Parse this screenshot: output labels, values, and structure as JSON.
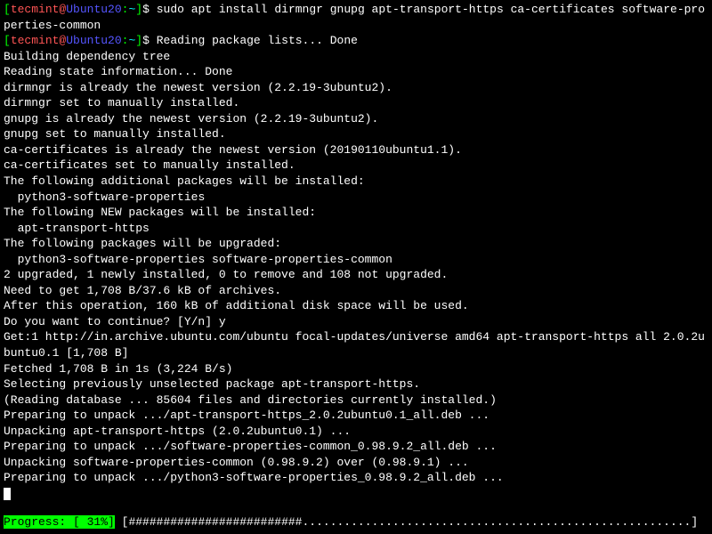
{
  "prompt1": {
    "user": "tecmint",
    "host": "Ubuntu20",
    "path": "~",
    "symbol": "$"
  },
  "command1": "sudo apt install dirmngr gnupg apt-transport-https ca-certificates software-properties-common",
  "prompt2": {
    "user": "tecmint",
    "host": "Ubuntu20",
    "path": "~",
    "symbol": "$"
  },
  "output_lines": [
    "Reading package lists... Done",
    "Building dependency tree",
    "Reading state information... Done",
    "dirmngr is already the newest version (2.2.19-3ubuntu2).",
    "dirmngr set to manually installed.",
    "gnupg is already the newest version (2.2.19-3ubuntu2).",
    "gnupg set to manually installed.",
    "ca-certificates is already the newest version (20190110ubuntu1.1).",
    "ca-certificates set to manually installed.",
    "The following additional packages will be installed:",
    "  python3-software-properties",
    "The following NEW packages will be installed:",
    "  apt-transport-https",
    "The following packages will be upgraded:",
    "  python3-software-properties software-properties-common",
    "2 upgraded, 1 newly installed, 0 to remove and 108 not upgraded.",
    "Need to get 1,708 B/37.6 kB of archives.",
    "After this operation, 160 kB of additional disk space will be used.",
    "Do you want to continue? [Y/n] y",
    "Get:1 http://in.archive.ubuntu.com/ubuntu focal-updates/universe amd64 apt-transport-https all 2.0.2ubuntu0.1 [1,708 B]",
    "Fetched 1,708 B in 1s (3,224 B/s)",
    "Selecting previously unselected package apt-transport-https.",
    "(Reading database ... 85604 files and directories currently installed.)",
    "Preparing to unpack .../apt-transport-https_2.0.2ubuntu0.1_all.deb ...",
    "Unpacking apt-transport-https (2.0.2ubuntu0.1) ...",
    "Preparing to unpack .../software-properties-common_0.98.9.2_all.deb ...",
    "Unpacking software-properties-common (0.98.9.2) over (0.98.9.1) ...",
    "Preparing to unpack .../python3-software-properties_0.98.9.2_all.deb ..."
  ],
  "progress": {
    "label": "Progress: [ 31%]",
    "bar_open": " [",
    "bar_fill": "#########################",
    "bar_empty": "........................................................",
    "bar_close": "] "
  }
}
